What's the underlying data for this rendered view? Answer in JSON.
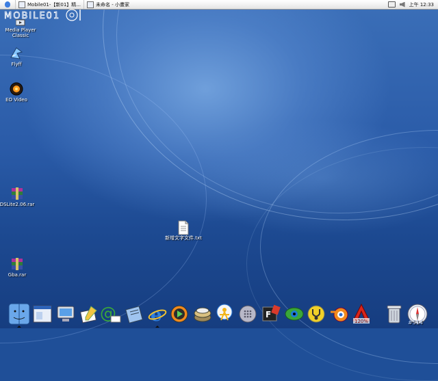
{
  "menubar": {
    "tasks": [
      {
        "label": "Mobile01-【新01】精..."
      },
      {
        "label": "未命名 - 小畫家"
      }
    ],
    "clock": "上午 12:33"
  },
  "watermark": {
    "text": "MOBILE01"
  },
  "desktop_icons": [
    {
      "label": "Media Player Classic",
      "icon": "media-player-icon"
    },
    {
      "label": "Flyff",
      "icon": "flyff-icon"
    },
    {
      "label": "EO Video",
      "icon": "eo-video-icon"
    },
    {
      "label": "DSLite2.06.rar",
      "icon": "winrar-archive-icon"
    },
    {
      "label": "Gba.rar",
      "icon": "winrar-archive-icon"
    },
    {
      "label": "新增文字文件.txt",
      "icon": "text-file-icon"
    }
  ],
  "dock": {
    "items": [
      "finder-icon",
      "window-manager-icon",
      "my-computer-icon",
      "paint-icon",
      "mail-icon",
      "notepad-icon",
      "internet-explorer-icon",
      "media-player-icon",
      "drive-icon",
      "messenger-icon",
      "grid-app-icon",
      "fireworks-icon",
      "eye-app-icon",
      "stethoscope-icon",
      "blender-icon",
      "acrobat-icon",
      "recycle-bin-icon",
      "safari-compass-icon"
    ],
    "zoom_badge": "120%"
  },
  "counter": "#514"
}
